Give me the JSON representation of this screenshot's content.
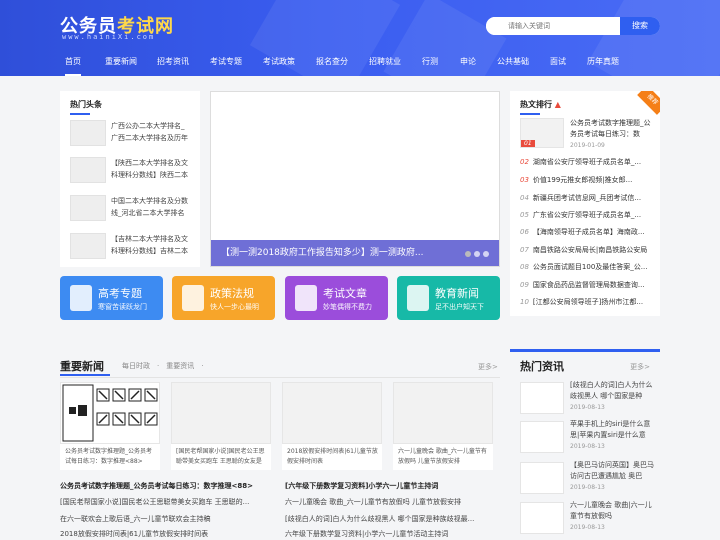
{
  "header": {
    "logo_main": "公务员",
    "logo_highlight": "考试网",
    "logo_sub": "www.hainiXi.com",
    "search_placeholder": "请输入关键词",
    "search_button": "搜索"
  },
  "nav": [
    "首页",
    "重要新闻",
    "招考资讯",
    "考试专题",
    "考试政策",
    "报名查分",
    "招聘就业",
    "行测",
    "申论",
    "公共基础",
    "面试",
    "历年真题"
  ],
  "hot_news": {
    "title": "热门头条",
    "items": [
      "广西公办二本大学排名_广西二本大学排名及历年",
      "【陕西二本大学排名及文科理科分数线】陕西二本",
      "中国二本大学排名及分数线_河北省二本大学排名",
      "【吉林二本大学排名及文科理科分数线】吉林二本"
    ]
  },
  "slider": {
    "caption": "【测一测2018政府工作报告知多少】测一测政府..."
  },
  "rank": {
    "title": "热文排行",
    "badge": "推荐",
    "top_title": "公务员考试数字推理题_公务员考试每日练习：数",
    "top_date": "2019-01-09",
    "top_num": "01",
    "items": [
      {
        "n": "02",
        "t": "湖南省公安厅领导班子成员名单_..."
      },
      {
        "n": "03",
        "t": "价值199元推女郎视频|推女郎..."
      },
      {
        "n": "04",
        "t": "新疆兵团考试信息网_兵团考试信..."
      },
      {
        "n": "05",
        "t": "广东省公安厅领导班子成员名单_..."
      },
      {
        "n": "06",
        "t": "【海南领导班子成员名单】海南政..."
      },
      {
        "n": "07",
        "t": "南昌铁路公安局局长|南昌铁路公安局"
      },
      {
        "n": "08",
        "t": "公务员面试题目100及最佳答案_公..."
      },
      {
        "n": "09",
        "t": "国家食品药品监督管理局数据查询..."
      },
      {
        "n": "10",
        "t": "[江都公安局领导班子]扬州市江都..."
      }
    ]
  },
  "categories": [
    {
      "title": "高考专题",
      "sub": "寒窗苦读跃龙门",
      "color": "#3d8bf2"
    },
    {
      "title": "政策法规",
      "sub": "快人一步心最明",
      "color": "#f7a52a"
    },
    {
      "title": "考试文章",
      "sub": "妙笔偶得不费力",
      "color": "#9b4ddb"
    },
    {
      "title": "教育新闻",
      "sub": "足不出户知天下",
      "color": "#17b9a7"
    }
  ],
  "important": {
    "title": "重要新闻",
    "tabs": "每日时政　·　重要资讯　·",
    "more": "更多>",
    "cards": [
      "公务员考试数字推理题_公务员考试每日练习：数字推理<88>",
      "[国民老帮国家小说]国民老公王思聪带美女买跑车 王思聪的女友是",
      "2018放假安排时间表|61儿童节放假安排时间表",
      "六一儿童晚会 歌曲_六一儿童节有放假吗 儿童节放假安排"
    ],
    "col1": [
      "公务员考试数字推理题_公务员考试每日练习：数字推理<88>",
      "[国民老帮国家小说]国民老公王思聪带美女买跑车 王思聪的...",
      "在六一联欢会上歌后语_六一儿童节联欢会主持稿",
      "2018放假安排时间表|61儿童节放假安排时间表"
    ],
    "col2": [
      "[六年级下册数学复习资料]小学六一儿童节主持词",
      "六一儿童晚会 歌曲_六一儿童节有放假吗 儿童节放假安排",
      "[歧视白人的词]白人为什么歧视黑人 哪个国家是种族歧视最...",
      "六年级下册数学复习资料|小学六一儿童节活动主持词"
    ]
  },
  "hot_info": {
    "title": "热门资讯",
    "more": "更多>",
    "items": [
      {
        "t": "[歧视白人的词]白人为什么歧视黑人 哪个国家是种",
        "d": "2019-08-13"
      },
      {
        "t": "苹果手机上的siri是什么意思|苹果内置siri是什么意",
        "d": "2019-08-13"
      },
      {
        "t": "【奥巴马访问英国】奥巴马访问古巴遭遇尴尬 奥巴",
        "d": "2019-08-13"
      },
      {
        "t": "六一儿童晚会 歌曲|六一儿童节有放假吗",
        "d": "2019-08-13"
      }
    ]
  }
}
